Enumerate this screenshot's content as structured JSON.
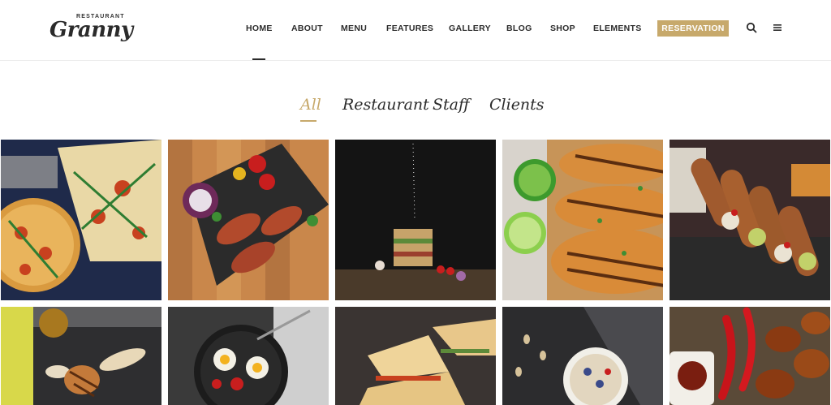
{
  "brand": {
    "small": "RESTAURANT",
    "name": "Granny"
  },
  "nav": {
    "items": [
      {
        "label": "HOME"
      },
      {
        "label": "ABOUT"
      },
      {
        "label": "MENU"
      },
      {
        "label": "FEATURES"
      },
      {
        "label": "GALLERY"
      },
      {
        "label": "BLOG"
      },
      {
        "label": "SHOP"
      },
      {
        "label": "ELEMENTS"
      }
    ],
    "reservation": "RESERVATION",
    "search_icon": "search-icon",
    "menu_icon": "hamburger-menu-icon"
  },
  "filters": [
    {
      "label": "All",
      "active": true
    },
    {
      "label": "Restaurant"
    },
    {
      "label": "Staff"
    },
    {
      "label": "Clients"
    }
  ],
  "colors": {
    "accent": "#c7a96b",
    "text": "#2b2b2b"
  },
  "gallery": {
    "tiles": [
      {
        "subject": "pizza"
      },
      {
        "subject": "bacon-wrapped-rolls"
      },
      {
        "subject": "stacked-sandwich"
      },
      {
        "subject": "grilled-bread-with-lime"
      },
      {
        "subject": "cannoli"
      },
      {
        "subject": "grilled-chicken"
      },
      {
        "subject": "fried-eggs-pan"
      },
      {
        "subject": "quesadillas"
      },
      {
        "subject": "breakfast-bowl"
      },
      {
        "subject": "chicken-wings-chili"
      }
    ]
  }
}
